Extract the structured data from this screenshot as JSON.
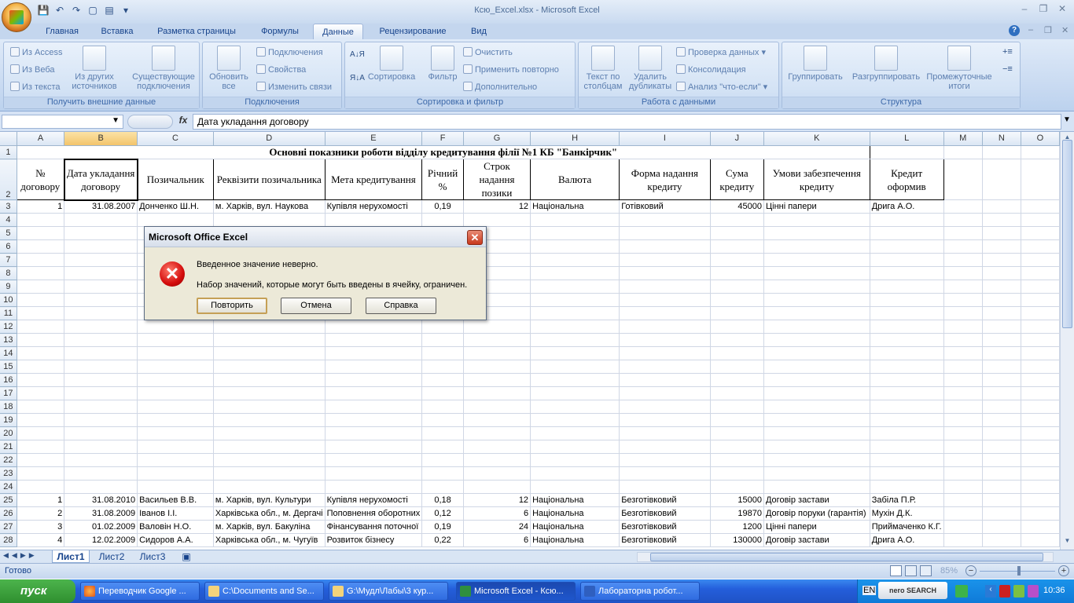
{
  "window": {
    "title": "Ксю_Excel.xlsx - Microsoft Excel"
  },
  "ribbon": {
    "tabs": [
      "Главная",
      "Вставка",
      "Разметка страницы",
      "Формулы",
      "Данные",
      "Рецензирование",
      "Вид"
    ],
    "active_tab": "Данные",
    "groups": {
      "external": {
        "label": "Получить внешние данные",
        "from_access": "Из Access",
        "from_web": "Из Веба",
        "from_text": "Из текста",
        "from_other": "Из других источников",
        "existing": "Существующие подключения"
      },
      "connections": {
        "label": "Подключения",
        "refresh": "Обновить все",
        "connections": "Подключения",
        "properties": "Свойства",
        "edit_links": "Изменить связи"
      },
      "sort": {
        "label": "Сортировка и фильтр",
        "sort": "Сортировка",
        "filter": "Фильтр",
        "clear": "Очистить",
        "reapply": "Применить повторно",
        "advanced": "Дополнительно"
      },
      "tools": {
        "label": "Работа с данными",
        "text_to_cols": "Текст по столбцам",
        "remove_dups": "Удалить дубликаты",
        "validation": "Проверка данных",
        "consolidate": "Консолидация",
        "whatif": "Анализ \"что-если\""
      },
      "outline": {
        "label": "Структура",
        "group": "Группировать",
        "ungroup": "Разгруппировать",
        "subtotal": "Промежуточные итоги"
      }
    }
  },
  "formula_bar": {
    "fx": "fx",
    "content": "Дата укладання договору"
  },
  "sheet": {
    "columns": [
      "A",
      "B",
      "C",
      "D",
      "E",
      "F",
      "G",
      "H",
      "I",
      "J",
      "K",
      "L",
      "M",
      "N",
      "O"
    ],
    "title": "Основні показники роботи відділу кредитування філії №1 КБ \"Банкірчик\"",
    "headers": [
      "№ договору",
      "Дата укладання договору",
      "Позичальник",
      "Реквізити позичальника",
      "Мета кредитування",
      "Річний %",
      "Строк надання позики",
      "Валюта",
      "Форма надання кредиту",
      "Сума кредиту",
      "Умови забезпечення кредиту",
      "Кредит оформив"
    ],
    "row3": [
      "1",
      "31.08.2007",
      "Донченко Ш.Н.",
      "м. Харків, вул. Наукова",
      "Купівля нерухомості",
      "0,19",
      "12",
      "Національна",
      "Готівковий",
      "45000",
      "Цінні папери",
      "Дрига А.О."
    ],
    "lower_rows": [
      {
        "n": "25",
        "cells": [
          "1",
          "31.08.2010",
          "Васильев В.В.",
          "м. Харків, вул. Культури",
          "Купівля нерухомості",
          "0,18",
          "12",
          "Національна",
          "Безготівковий",
          "15000",
          "Договір застави",
          "Забіла П.Р."
        ]
      },
      {
        "n": "26",
        "cells": [
          "2",
          "31.08.2009",
          "Іванов І.І.",
          "Харківська обл., м. Дергачі",
          "Поповнення оборотних",
          "0,12",
          "6",
          "Національна",
          "Безготівковий",
          "19870",
          "Договір поруки (гарантія)",
          "Мухін Д.К."
        ]
      },
      {
        "n": "27",
        "cells": [
          "3",
          "01.02.2009",
          "Валовін Н.О.",
          "м. Харків, вул. Бакуліна",
          "Фінансування поточної",
          "0,19",
          "24",
          "Національна",
          "Безготівковий",
          "1200",
          "Цінні папери",
          "Приймаченко К.Г."
        ]
      },
      {
        "n": "28",
        "cells": [
          "4",
          "12.02.2009",
          "Сидоров А.А.",
          "Харківська обл., м. Чугуїв",
          "Розвиток бізнесу",
          "0,22",
          "6",
          "Національна",
          "Безготівковий",
          "130000",
          "Договір застави",
          "Дрига А.О."
        ]
      }
    ],
    "empty_rows": [
      "4",
      "5",
      "6",
      "7",
      "8",
      "9",
      "10",
      "11",
      "12",
      "13",
      "14",
      "15",
      "16",
      "17",
      "18",
      "19",
      "20",
      "21",
      "22",
      "23",
      "24"
    ],
    "tabs": [
      "Лист1",
      "Лист2",
      "Лист3"
    ]
  },
  "status": {
    "ready": "Готово",
    "zoom": "85%"
  },
  "dialog": {
    "title": "Microsoft Office Excel",
    "message1": "Введенное значение неверно.",
    "message2": "Набор значений, которые могут быть введены в ячейку, ограничен.",
    "retry": "Повторить",
    "cancel": "Отмена",
    "help": "Справка"
  },
  "taskbar": {
    "start": "пуск",
    "items": [
      "Переводчик Google ...",
      "C:\\Documents and Se...",
      "G:\\Мудл\\Лабы\\3 кур...",
      "Microsoft Excel - Ксю...",
      "Лабораторна робот..."
    ],
    "lang": "EN",
    "search": "nero SEARCH",
    "clock": "10:36"
  }
}
